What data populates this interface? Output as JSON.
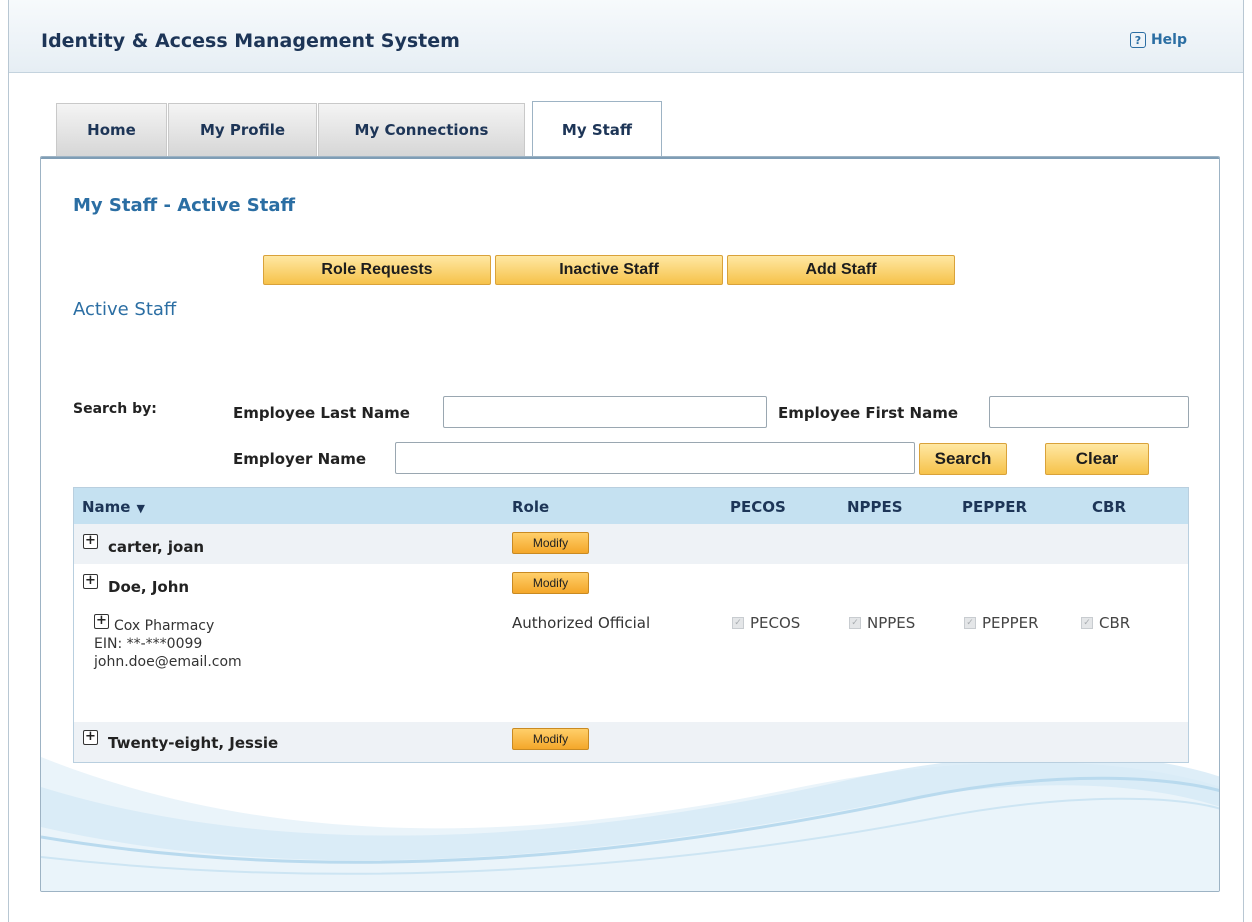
{
  "header": {
    "app_title": "Identity & Access Management System",
    "help_label": "Help",
    "help_icon": "help-icon"
  },
  "tabs": [
    {
      "label": "Home",
      "active": false
    },
    {
      "label": "My Profile",
      "active": false
    },
    {
      "label": "My Connections",
      "active": false
    },
    {
      "label": "My Staff",
      "active": true
    }
  ],
  "page": {
    "title": "My Staff - Active Staff",
    "section_title": "Active Staff"
  },
  "actions": {
    "role_requests": "Role Requests",
    "inactive_staff": "Inactive Staff",
    "add_staff": "Add Staff"
  },
  "search": {
    "label": "Search by:",
    "last_name_label": "Employee Last Name",
    "last_name_value": "",
    "first_name_label": "Employee First Name",
    "first_name_value": "",
    "employer_label": "Employer Name",
    "employer_value": "",
    "search_button": "Search",
    "clear_button": "Clear"
  },
  "table": {
    "columns": [
      "Name",
      "Role",
      "PECOS",
      "NPPES",
      "PEPPER",
      "CBR"
    ],
    "sort_icon": "sort-down-icon",
    "modify_label": "Modify",
    "rows": [
      {
        "name": "carter, joan"
      },
      {
        "name": "Doe, John",
        "org": {
          "name": "Cox Pharmacy",
          "ein": "EIN: **-***0099",
          "email": "john.doe@email.com",
          "role": "Authorized Official",
          "checks": [
            "PECOS",
            "NPPES",
            "PEPPER",
            "CBR"
          ]
        }
      },
      {
        "name": "Twenty-eight, Jessie"
      }
    ]
  },
  "colors": {
    "accent": "#2b6ea3",
    "title_navy": "#1d3557",
    "header_row": "#c5e1f1",
    "button_yellow": "#f6c24a",
    "modify_orange": "#f4a72a"
  }
}
